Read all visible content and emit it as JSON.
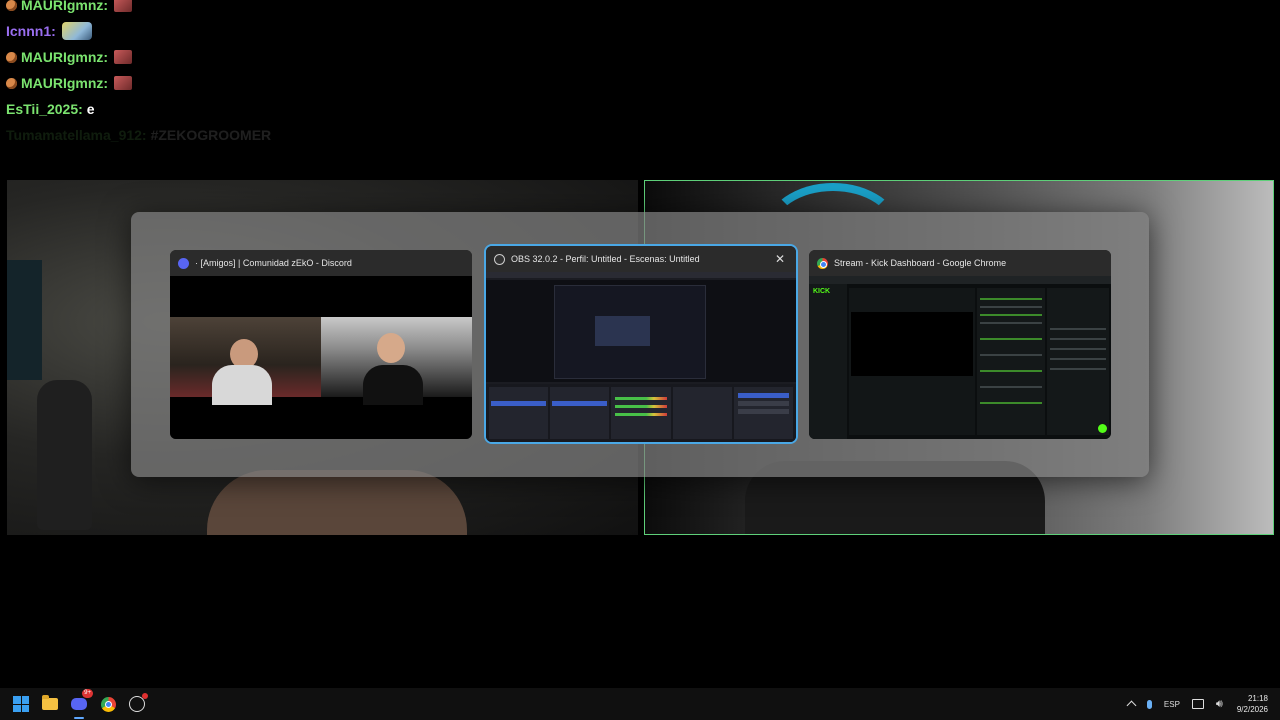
{
  "chat": [
    {
      "user": "MAURIgmnz:",
      "color": "#7be36f",
      "badge": true,
      "message": "",
      "emote": "pepe-emote"
    },
    {
      "user": "Icnnn1:",
      "color": "#9a6ef0",
      "badge": false,
      "message": "",
      "emote": "wide-emote"
    },
    {
      "user": "MAURIgmnz:",
      "color": "#7be36f",
      "badge": true,
      "message": "",
      "emote": "pepe-emote"
    },
    {
      "user": "MAURIgmnz:",
      "color": "#7be36f",
      "badge": true,
      "message": "",
      "emote": "pepe-emote"
    },
    {
      "user": "EsTii_2025:",
      "color": "#7be36f",
      "badge": false,
      "message": "e",
      "emote": ""
    },
    {
      "user": "Tumamatellama_912:",
      "color": "#7be36f",
      "badge": false,
      "message": "#ZEKOGROOMER",
      "emote": "",
      "faded": true
    }
  ],
  "switcher": {
    "windows": [
      {
        "title": "· [Amigos] | Comunidad zEkO - Discord",
        "app": "discord",
        "icon": "discord-icon"
      },
      {
        "title": "OBS 32.0.2 - Perfil: Untitled - Escenas: Untitled",
        "app": "obs",
        "icon": "obs-icon",
        "selected": true,
        "close_label": "✕"
      },
      {
        "title": "Stream - Kick Dashboard - Google Chrome",
        "app": "chrome",
        "icon": "chrome-icon"
      }
    ],
    "kick_logo": "KICK"
  },
  "taskbar": {
    "apps": [
      "start",
      "file-explorer",
      "discord",
      "chrome",
      "obs"
    ],
    "discord_badge": "9+",
    "tray": {
      "language": "ESP",
      "time": "21:18",
      "date": "9/2/2026"
    }
  },
  "colors": {
    "accent": "#4aa8e6",
    "cam_border": "#5fd07a",
    "chat_green": "#7be36f",
    "chat_purple": "#9a6ef0",
    "kick_green": "#53fc18"
  }
}
